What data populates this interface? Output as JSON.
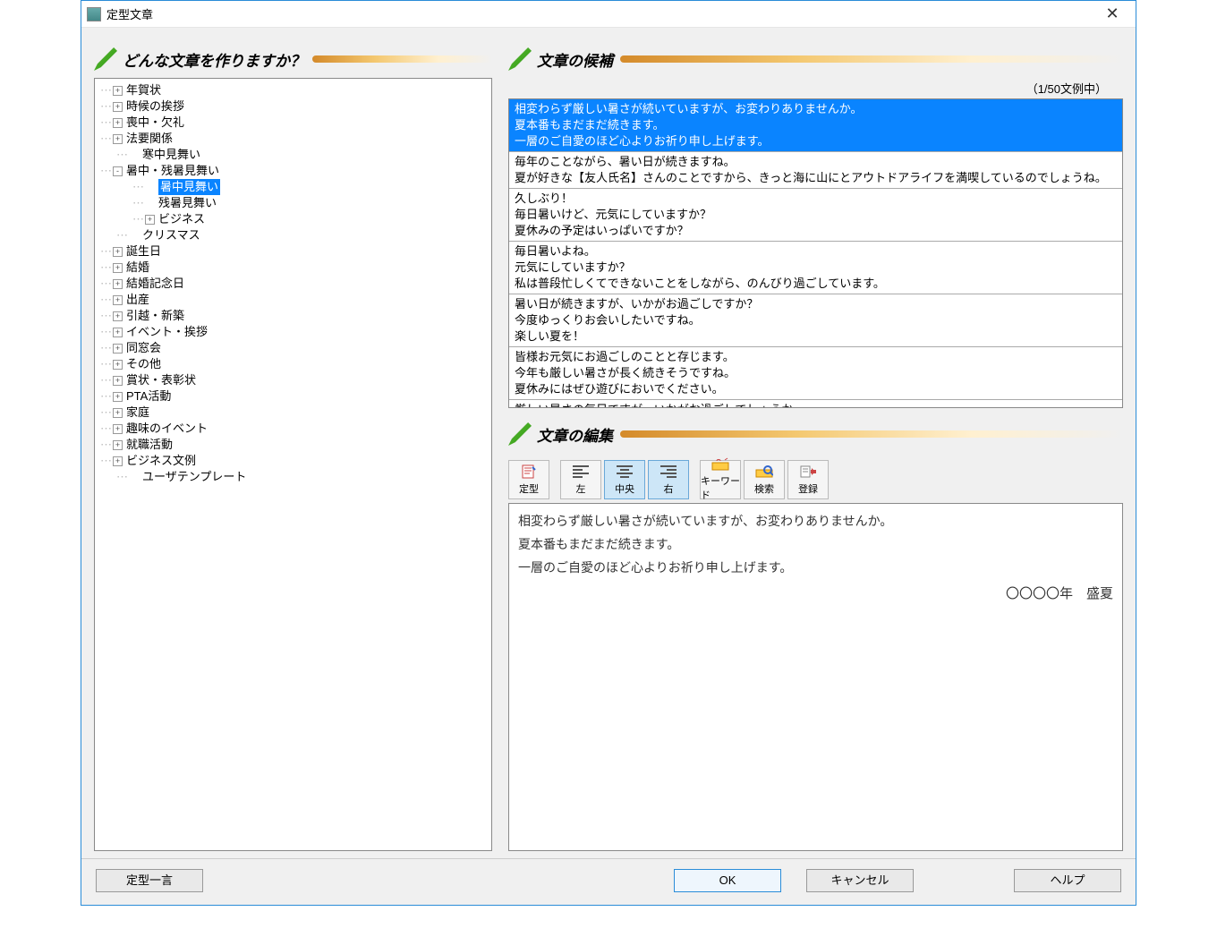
{
  "window": {
    "title": "定型文章",
    "close": "✕"
  },
  "left": {
    "header": "どんな文章を作りますか？",
    "tree": [
      {
        "indent": 0,
        "toggle": "+",
        "label": "年賀状"
      },
      {
        "indent": 0,
        "toggle": "+",
        "label": "時候の挨拶"
      },
      {
        "indent": 0,
        "toggle": "+",
        "label": "喪中・欠礼"
      },
      {
        "indent": 0,
        "toggle": "+",
        "label": "法要関係"
      },
      {
        "indent": 1,
        "toggle": "",
        "label": "寒中見舞い"
      },
      {
        "indent": 0,
        "toggle": "-",
        "label": "暑中・残暑見舞い"
      },
      {
        "indent": 2,
        "toggle": "",
        "label": "暑中見舞い",
        "selected": true
      },
      {
        "indent": 2,
        "toggle": "",
        "label": "残暑見舞い"
      },
      {
        "indent": 2,
        "toggle": "+",
        "label": "ビジネス"
      },
      {
        "indent": 1,
        "toggle": "",
        "label": "クリスマス"
      },
      {
        "indent": 0,
        "toggle": "+",
        "label": "誕生日"
      },
      {
        "indent": 0,
        "toggle": "+",
        "label": "結婚"
      },
      {
        "indent": 0,
        "toggle": "+",
        "label": "結婚記念日"
      },
      {
        "indent": 0,
        "toggle": "+",
        "label": "出産"
      },
      {
        "indent": 0,
        "toggle": "+",
        "label": "引越・新築"
      },
      {
        "indent": 0,
        "toggle": "+",
        "label": "イベント・挨拶"
      },
      {
        "indent": 0,
        "toggle": "+",
        "label": "同窓会"
      },
      {
        "indent": 0,
        "toggle": "+",
        "label": "その他"
      },
      {
        "indent": 0,
        "toggle": "+",
        "label": "賞状・表彰状"
      },
      {
        "indent": 0,
        "toggle": "+",
        "label": "PTA活動"
      },
      {
        "indent": 0,
        "toggle": "+",
        "label": "家庭"
      },
      {
        "indent": 0,
        "toggle": "+",
        "label": "趣味のイベント"
      },
      {
        "indent": 0,
        "toggle": "+",
        "label": "就職活動"
      },
      {
        "indent": 0,
        "toggle": "+",
        "label": "ビジネス文例"
      },
      {
        "indent": 1,
        "toggle": "",
        "label": "ユーザテンプレート"
      }
    ]
  },
  "candidates": {
    "header": "文章の候補",
    "counter": "（1/50文例中）",
    "items": [
      {
        "lines": [
          "相変わらず厳しい暑さが続いていますが、お変わりありませんか。",
          "夏本番もまだまだ続きます。",
          "一層のご自愛のほど心よりお祈り申し上げます。"
        ],
        "selected": true
      },
      {
        "lines": [
          "毎年のことながら、暑い日が続きますね。",
          "夏が好きな【友人氏名】さんのことですから、きっと海に山にとアウトドアライフを満喫しているのでしょうね。"
        ]
      },
      {
        "lines": [
          "久しぶり！",
          "毎日暑いけど、元気にしていますか？",
          "夏休みの予定はいっぱいですか？"
        ]
      },
      {
        "lines": [
          "毎日暑いよね。",
          "元気にしていますか？",
          "私は普段忙しくてできないことをしながら、のんびり過ごしています。"
        ]
      },
      {
        "lines": [
          "暑い日が続きますが、いかがお過ごしですか？",
          "今度ゆっくりお会いしたいですね。",
          "楽しい夏を！"
        ]
      },
      {
        "lines": [
          "皆様お元気にお過ごしのことと存じます。",
          "今年も厳しい暑さが長く続きそうですね。",
          "夏休みにはぜひ遊びにおいでください。"
        ]
      },
      {
        "lines": [
          "厳しい暑さの毎日ですが、いかがお過ごしでしょうか。"
        ]
      }
    ]
  },
  "edit": {
    "header": "文章の編集",
    "tools": {
      "teikei": "定型",
      "left": "左",
      "center": "中央",
      "right": "右",
      "keyword": "キーワード",
      "search": "検索",
      "register": "登録"
    },
    "body": [
      "相変わらず厳しい暑さが続いていますが、お変わりありませんか。",
      "夏本番もまだまだ続きます。",
      "一層のご自愛のほど心よりお祈り申し上げます。"
    ],
    "signature": "〇〇〇〇年　盛夏"
  },
  "buttons": {
    "teikei_hitokoto": "定型一言",
    "ok": "OK",
    "cancel": "キャンセル",
    "help": "ヘルプ"
  }
}
